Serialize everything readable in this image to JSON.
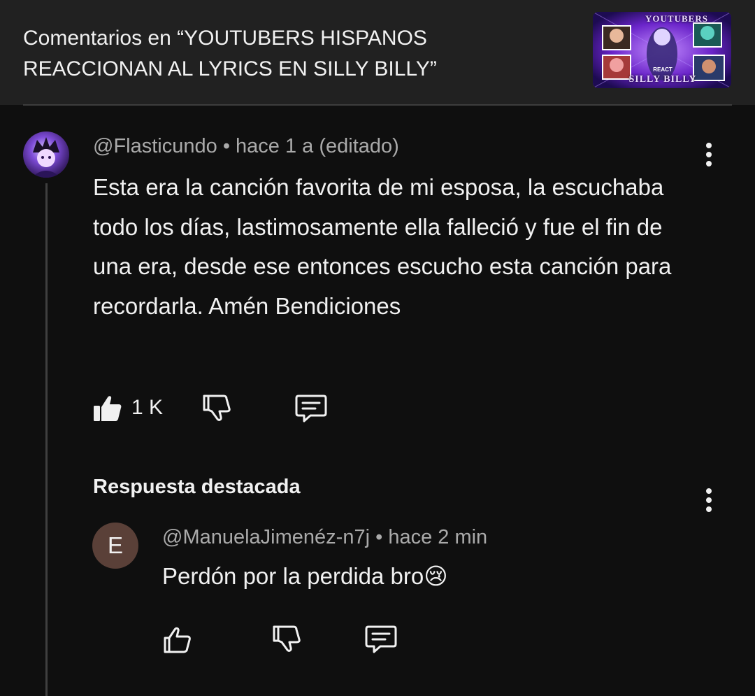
{
  "header": {
    "title_line1": "Comentarios en “YOUTUBERS HISPANOS",
    "title_line2": "REACCIONAN AL LYRICS EN SILLY BILLY”",
    "thumbnail": {
      "top_text": "YOUTUBERS",
      "bottom_text": "SILLY BILLY",
      "middle_text": "REACT"
    }
  },
  "comment": {
    "author": "@Flasticundo",
    "separator": "•",
    "time": "hace 1 a (editado)",
    "text": "Esta era la canción favorita de mi esposa, la escuchaba todo los días, lastimosamente ella falleció y fue el fin de una era, desde ese entonces escucho esta canción para recordarla. Amén Bendiciones",
    "likes": "1 K"
  },
  "featured_reply_label": "Respuesta destacada",
  "reply": {
    "avatar_letter": "E",
    "author": "@ManuelaJimenéz-n7j",
    "separator": "•",
    "time": "hace 2 min",
    "text": "Perdón por la perdida bro",
    "emoji": "😢"
  },
  "colors": {
    "background": "#0f0f0f",
    "header_bg": "#212121",
    "text_primary": "#f1f1f1",
    "text_secondary": "#aaaaaa",
    "reply_avatar": "#5a4038"
  }
}
